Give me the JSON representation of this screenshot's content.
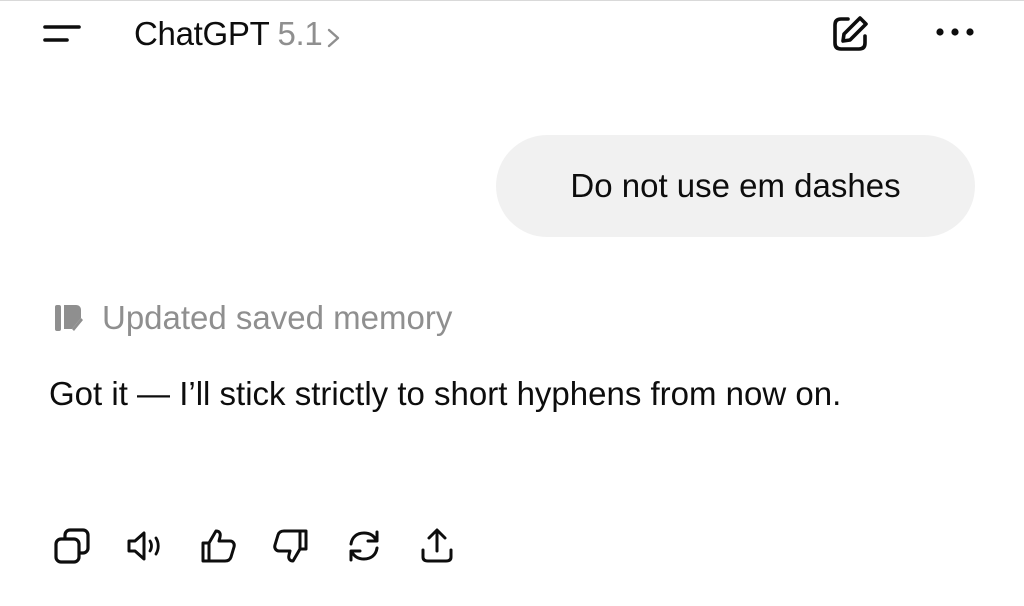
{
  "header": {
    "app_name": "ChatGPT",
    "model_version": "5.1",
    "menu_icon": "hamburger-menu-icon",
    "chevron_icon": "chevron-right-icon",
    "compose_icon": "new-chat-compose-icon",
    "more_icon": "more-options-icon"
  },
  "conversation": {
    "user_message": "Do not use em dashes",
    "memory_note": "Updated saved memory",
    "memory_icon": "memory-icon",
    "assistant_message": "Got it — I’ll stick strictly to short hyphens from now on."
  },
  "actions": [
    {
      "name": "copy",
      "icon": "copy-icon"
    },
    {
      "name": "read-aloud",
      "icon": "speaker-icon"
    },
    {
      "name": "good-response",
      "icon": "thumbs-up-icon"
    },
    {
      "name": "bad-response",
      "icon": "thumbs-down-icon"
    },
    {
      "name": "regenerate",
      "icon": "regenerate-icon"
    },
    {
      "name": "share",
      "icon": "share-icon"
    }
  ],
  "colors": {
    "text_primary": "#0d0d0d",
    "text_secondary": "#8f8f8f",
    "bubble_background": "#f1f1f1",
    "background": "#ffffff"
  }
}
